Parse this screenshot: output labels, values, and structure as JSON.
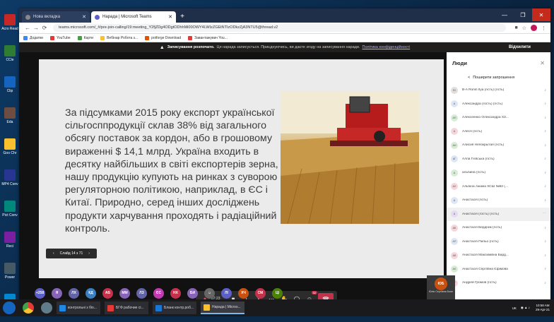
{
  "desktop": {
    "icons": [
      {
        "label": "Acro Read",
        "color": "#c62828"
      },
      {
        "label": "CCle",
        "color": "#2e7d32"
      },
      {
        "label": "Clip",
        "color": "#1565c0"
      },
      {
        "label": "Eda",
        "color": "#6d4c41"
      },
      {
        "label": "Goo Chr",
        "color": "#fbc02d"
      },
      {
        "label": "MP4 Conv",
        "color": "#283593"
      },
      {
        "label": "Pict Conv",
        "color": "#00897b"
      },
      {
        "label": "Reci",
        "color": "#7b1fa2"
      },
      {
        "label": "Power",
        "color": "#455a64"
      },
      {
        "label": "Sky",
        "color": "#0288d1"
      }
    ]
  },
  "browser": {
    "tabs": [
      {
        "label": "Нова вкладка",
        "active": false,
        "fav": "#888"
      },
      {
        "label": "Нарада | Microsoft Teams",
        "active": true,
        "fav": "#5b5fc7"
      }
    ],
    "url": "teams.microsoft.com/_#/pre-join-calling/19:meeting_Y2fjZDg4ODgtODhhMi00OWY4LWIzZGEtNTIzODkzZjA3NTU5@thread.v2",
    "bookmarks": [
      {
        "label": "Додатки",
        "color": "#4285f4"
      },
      {
        "label": "YouTube",
        "color": "#e53935"
      },
      {
        "label": "Карти",
        "color": "#43a047"
      },
      {
        "label": "Вебінар Робота з...",
        "color": "#fbc02d"
      },
      {
        "label": "potforge Download",
        "color": "#e65100"
      },
      {
        "label": "Завантажувач You...",
        "color": "#e53935"
      }
    ]
  },
  "recording": {
    "bold": "Записування розпочато.",
    "text": "Ця нарада записується. Приєднуючись, ви даєте згоду на записування наради.",
    "link": "Політика конфіденційності",
    "dismiss": "Відхилити"
  },
  "slide": {
    "text": "За підсумками 2015 року експорт української сільгосппродукції склав 38% від загального обсягу поставок за кордон, або в грошовому вираженні $ 14,1 млрд. Україна входить в десятку найбільших в світі експортерів зерна, і нашу продукцію купують на ринках з суворою регуляторною політикою, наприклад, в ЄС і Китаї. Природно, серед інших досліджень продукти харчування проходять і радіаційний контроль.",
    "nav_label": "Слайд 14 з 71",
    "presenter": "Юлія Сергіївна Боян"
  },
  "callbar": {
    "timer": "07:23",
    "participants_badge": "32"
  },
  "avatars": [
    {
      "label": "+258",
      "color": "#5b5fc7"
    },
    {
      "label": "Я",
      "color": "#8764b8"
    },
    {
      "label": "ЛХ",
      "color": "#6264a7"
    },
    {
      "label": "КД",
      "color": "#3a7fc1"
    },
    {
      "label": "АБ",
      "color": "#c4314b"
    },
    {
      "label": "ММ",
      "color": "#8764b8"
    },
    {
      "label": "ЛЗ",
      "color": "#6264a7"
    },
    {
      "label": "ЄС",
      "color": "#c239b3"
    },
    {
      "label": "НХ",
      "color": "#c4314b"
    },
    {
      "label": "БИ",
      "color": "#8764b8"
    },
    {
      "label": "",
      "color": "#666"
    },
    {
      "label": "ЛІ",
      "color": "#5b5fc7"
    },
    {
      "label": "ХЧ",
      "color": "#ca5010"
    },
    {
      "label": "СМ",
      "color": "#c4314b"
    },
    {
      "label": "ЦІ",
      "color": "#498205"
    },
    {
      "label": "ЮБ",
      "color": "#ca5010"
    }
  ],
  "selfview_label": "Юлія Сергіївна Боян",
  "people": {
    "title": "Люди",
    "share": "Поширити запрошення",
    "list": [
      {
        "initials": "BI",
        "name": "B-A Ronin Ilya (гість) (гість)",
        "color": "#e1dfdd",
        "sel": false
      },
      {
        "initials": "A",
        "name": "Александра (гость) (гість)",
        "color": "#dce6f4",
        "sel": false
      },
      {
        "initials": "АП",
        "name": "Алексеенко Олександра ХЗ...",
        "color": "#d7ecd4",
        "sel": false
      },
      {
        "initials": "A",
        "name": "Алеся (гість)",
        "color": "#f4d6db",
        "sel": false
      },
      {
        "initials": "АН",
        "name": "Алисия Непокрытая (гість)",
        "color": "#d7ecd4",
        "sel": false
      },
      {
        "initials": "АГ",
        "name": "Алла Гієвська (гість)",
        "color": "#dce6f4",
        "sel": false
      },
      {
        "initials": "A",
        "name": "альбина (гість)",
        "color": "#d7ecd4",
        "sel": false
      },
      {
        "initials": "АХ",
        "name": "Альбіна Ажажа ХСШ №62 (...",
        "color": "#f4d6db",
        "sel": false
      },
      {
        "initials": "A",
        "name": "Анастасія (гість)",
        "color": "#dce6f4",
        "sel": false
      },
      {
        "initials": "A",
        "name": "Анастасія (гость) (гість)",
        "color": "#e3dcf4",
        "sel": true
      },
      {
        "initials": "АБ",
        "name": "Анастасія Бердник (гість)",
        "color": "#f4d6db",
        "sel": false
      },
      {
        "initials": "АП",
        "name": "Анастасія Пильо (гість)",
        "color": "#dce6f4",
        "sel": false
      },
      {
        "initials": "АБ",
        "name": "Анастасія Максимівна Бард...",
        "color": "#f4d6db",
        "sel": false
      },
      {
        "initials": "АЄ",
        "name": "Анастасія Сергіївна Єфімова",
        "color": "#d7ecd4",
        "sel": false
      },
      {
        "initials": "АГ",
        "name": "Андрей Громов (гість)",
        "color": "#f4d6db",
        "sel": false
      }
    ]
  },
  "taskbar": {
    "tasks": [
      {
        "label": "контрольні з біо...",
        "color": "#1e88e5",
        "active": false
      },
      {
        "label": "БГФ рабочие сі...",
        "color": "#e53935",
        "active": false
      },
      {
        "label": "Бланк контр.роб...",
        "color": "#1976d2",
        "active": false
      },
      {
        "label": "Нарада | Micros...",
        "color": "#fbc02d",
        "active": true
      }
    ],
    "lang": "UK",
    "time": "10:58 AM",
    "date": "29-Apr-21"
  }
}
